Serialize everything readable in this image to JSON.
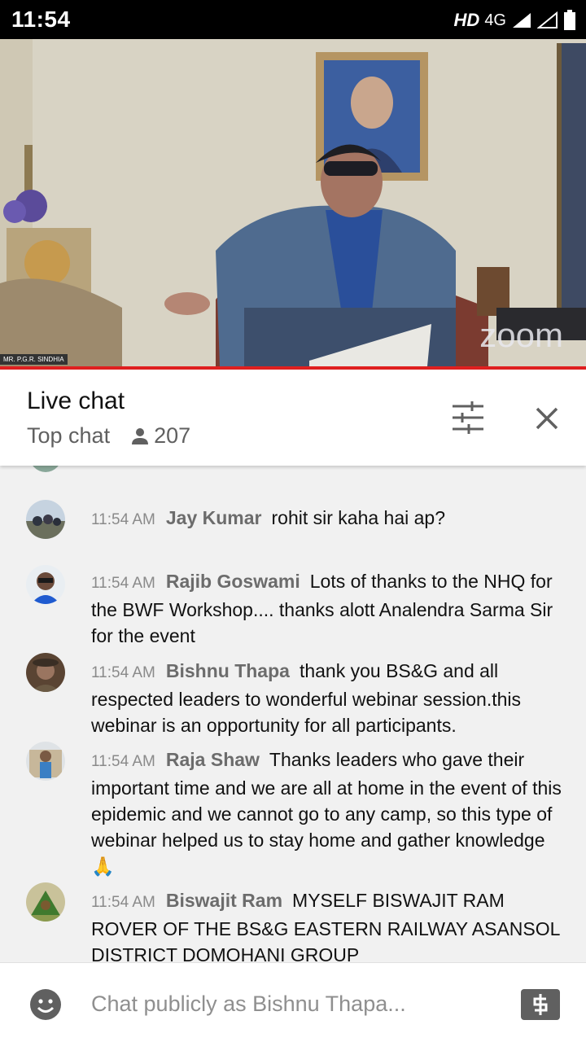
{
  "status_bar": {
    "time": "11:54",
    "hd_label": "HD",
    "network_label": "4G"
  },
  "video": {
    "watermark": "zoom",
    "name_tag": "MR. P.G.R. SINDHIA"
  },
  "chat_header": {
    "title": "Live chat",
    "mode": "Top chat",
    "viewer_count": "207"
  },
  "messages": [
    {
      "time": "11:54 AM",
      "author": "Jay Kumar",
      "text": "rohit sir kaha hai ap?"
    },
    {
      "time": "11:54 AM",
      "author": "Rajib Goswami",
      "text": "Lots of thanks to the NHQ for the BWF Workshop.... thanks alott Analendra Sarma Sir for the event"
    },
    {
      "time": "11:54 AM",
      "author": "Bishnu Thapa",
      "text": "thank you BS&G and all respected leaders to wonderful webinar session.this webinar is an opportunity for all participants."
    },
    {
      "time": "11:54 AM",
      "author": "Raja Shaw",
      "text": "Thanks leaders who gave their important time and we are all at home in the event of this epidemic and we cannot go to any camp, so this type of webinar helped us to stay home and gather knowledge 🙏"
    },
    {
      "time": "11:54 AM",
      "author": "Biswajit Ram",
      "text": "MYSELF BISWAJIT RAM ROVER OF THE BS&G EASTERN RAILWAY ASANSOL DISTRICT DOMOHANI GROUP"
    }
  ],
  "input": {
    "placeholder": "Chat publicly as Bishnu Thapa..."
  },
  "colors": {
    "progress": "#e02020",
    "background": "#f1f1f1"
  }
}
